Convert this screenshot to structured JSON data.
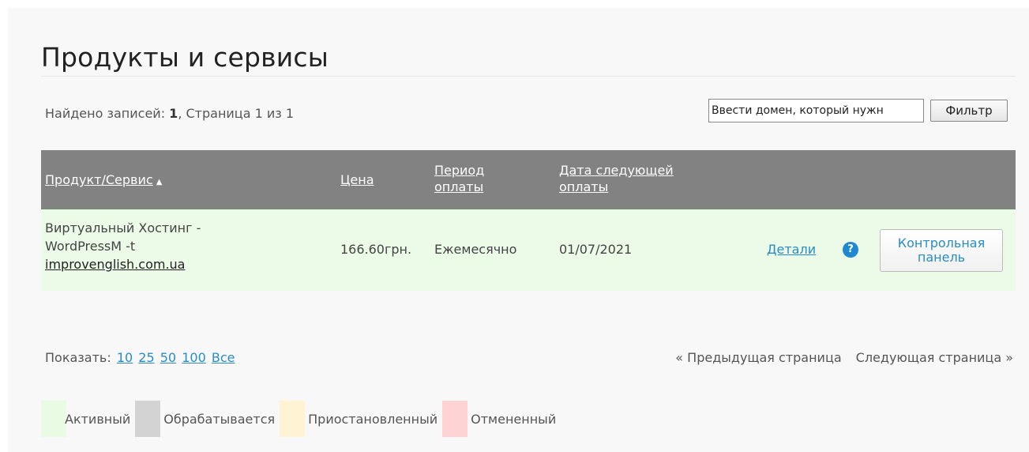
{
  "page": {
    "title": "Продукты и сервисы"
  },
  "summary": {
    "prefix": "Найдено записей: ",
    "count": "1",
    "suffix": ", Страница 1 из 1"
  },
  "filter": {
    "input_value": "Ввести домен, который нужн",
    "button_label": "Фильтр"
  },
  "table": {
    "headers": {
      "product": "Продукт/Сервис",
      "sort_indicator": "▲",
      "price": "Цена",
      "period_line1": "Период",
      "period_line2": "оплаты",
      "next_line1": "Дата следующей",
      "next_line2": "оплаты"
    },
    "rows": [
      {
        "product_line1": "Виртуальный Хостинг -",
        "product_line2": "WordPressM -t",
        "domain": "improvenglish.com.ua",
        "price": "166.60грн.",
        "period": "Ежемесячно",
        "next_due": "01/07/2021",
        "details": "Детали",
        "help": "?",
        "cp_line1": "Контрольная",
        "cp_line2": "панель"
      }
    ]
  },
  "show": {
    "label": "Показать:",
    "options": [
      "10",
      "25",
      "50",
      "100",
      "Все"
    ]
  },
  "pager": {
    "prev": "« Предыдущая страница",
    "next": "Следующая страница »"
  },
  "legend": [
    {
      "label": "Активный",
      "color": "#e9fbe3"
    },
    {
      "label": "Обрабатывается",
      "color": "#d3d3d3"
    },
    {
      "label": "Приостановленный",
      "color": "#fff3d4"
    },
    {
      "label": "Отмененный",
      "color": "#ffd3d3"
    }
  ],
  "colors": {
    "header_bg": "#828282",
    "active_row": "#ebfbe8",
    "link": "#2a8cc7",
    "help_icon": "#1e88d0"
  }
}
